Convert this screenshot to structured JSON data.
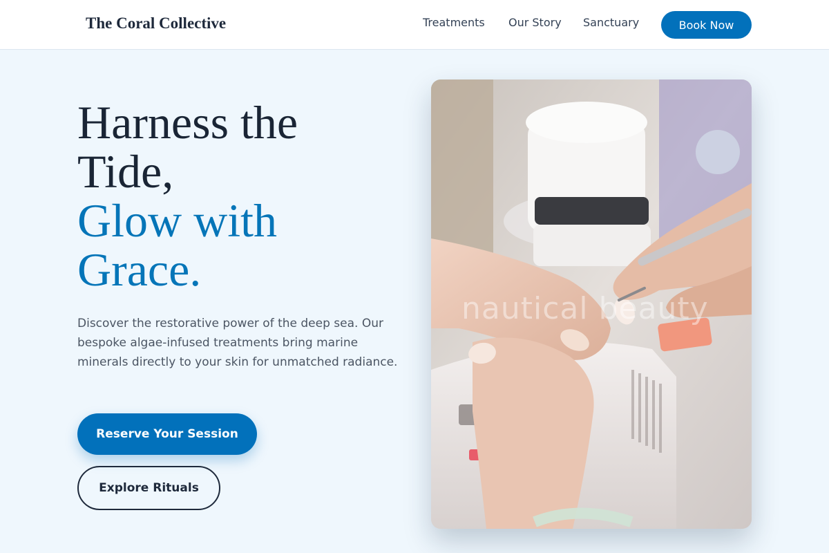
{
  "header": {
    "brand": "The Coral Collective",
    "nav": [
      "Treatments",
      "Our Story",
      "Sanctuary"
    ],
    "cta_label": "Book Now"
  },
  "hero": {
    "heading_line1": "Harness the",
    "heading_line2": "Tide,",
    "heading_accent_line1": "Glow with",
    "heading_accent_line2": "Grace.",
    "description": "Discover the restorative power of the deep sea. Our bespoke algae-infused treatments bring marine minerals directly to your skin for unmatched radiance.",
    "primary_cta": "Reserve Your Session",
    "secondary_cta": "Explore Rituals",
    "image_watermark": "nautical beauty"
  },
  "colors": {
    "accent": "#0271bb",
    "heading": "#1a2535",
    "background": "#eff7fd"
  }
}
